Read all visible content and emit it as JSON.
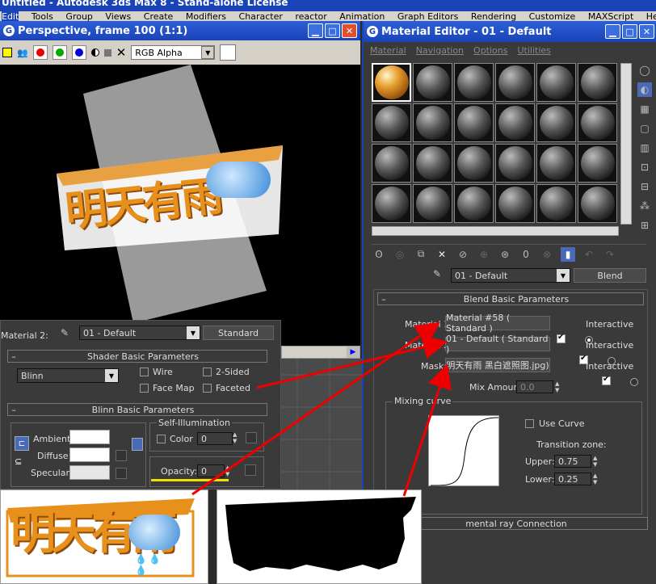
{
  "app": {
    "title_bar": "Untitled - Autodesk 3ds Max 8 - Stand-alone License",
    "menu": [
      "Edit",
      "Tools",
      "Group",
      "Views",
      "Create",
      "Modifiers",
      "Character",
      "reactor",
      "Animation",
      "Graph Editors",
      "Rendering",
      "Customize",
      "MAXScript",
      "Help"
    ]
  },
  "render_window": {
    "title": "Perspective, frame 100 (1:1)",
    "channel_select": "RGB Alpha",
    "logo_text": "明天有雨"
  },
  "material_panel_left": {
    "material_label": "Material 2:",
    "material_name": "01 - Default",
    "type_button": "Standard",
    "shader_rollout": "Shader Basic Parameters",
    "shader_value": "Blinn",
    "wire": "Wire",
    "two_sided": "2-Sided",
    "face_map": "Face Map",
    "faceted": "Faceted",
    "blinn_rollout": "Blinn Basic Parameters",
    "self_illum": "Self-Illumination",
    "color_label": "Color",
    "color_value": "0",
    "ambient": "Ambient:",
    "diffuse": "Diffuse:",
    "specular": "Specular:",
    "opacity_label": "Opacity:",
    "opacity_value": "0"
  },
  "material_editor": {
    "title": "Material Editor - 01 - Default",
    "menu": [
      "Material",
      "Navigation",
      "Options",
      "Utilities"
    ],
    "name_field": "01 - Default",
    "type_button": "Blend",
    "rollout": "Blend Basic Parameters",
    "material1_label": "Material 1:",
    "material1_value": "Material #58  ( Standard )",
    "material2_label": "Material 2:",
    "material2_value": "01 - Default  ( Standard )",
    "mask_label": "Mask:",
    "mask_value": "明天有雨 黑白遮照图.jpg)",
    "interactive": "Interactive",
    "mix_amount_label": "Mix Amount:",
    "mix_amount_value": "0.0",
    "mixing_curve": "Mixing curve",
    "use_curve": "Use Curve",
    "transition_zone": "Transition zone:",
    "upper_label": "Upper:",
    "upper_value": "0.75",
    "lower_label": "Lower:",
    "lower_value": "0.25",
    "mental_ray": "mental ray Connection"
  },
  "overlay_images": {
    "color_logo_text": "明天有雨"
  },
  "colors": {
    "title_blue": "#1f4fcf",
    "logo_orange": "#e8901c",
    "arrow_red": "#e00000",
    "highlight_yellow": "#f0e000"
  }
}
